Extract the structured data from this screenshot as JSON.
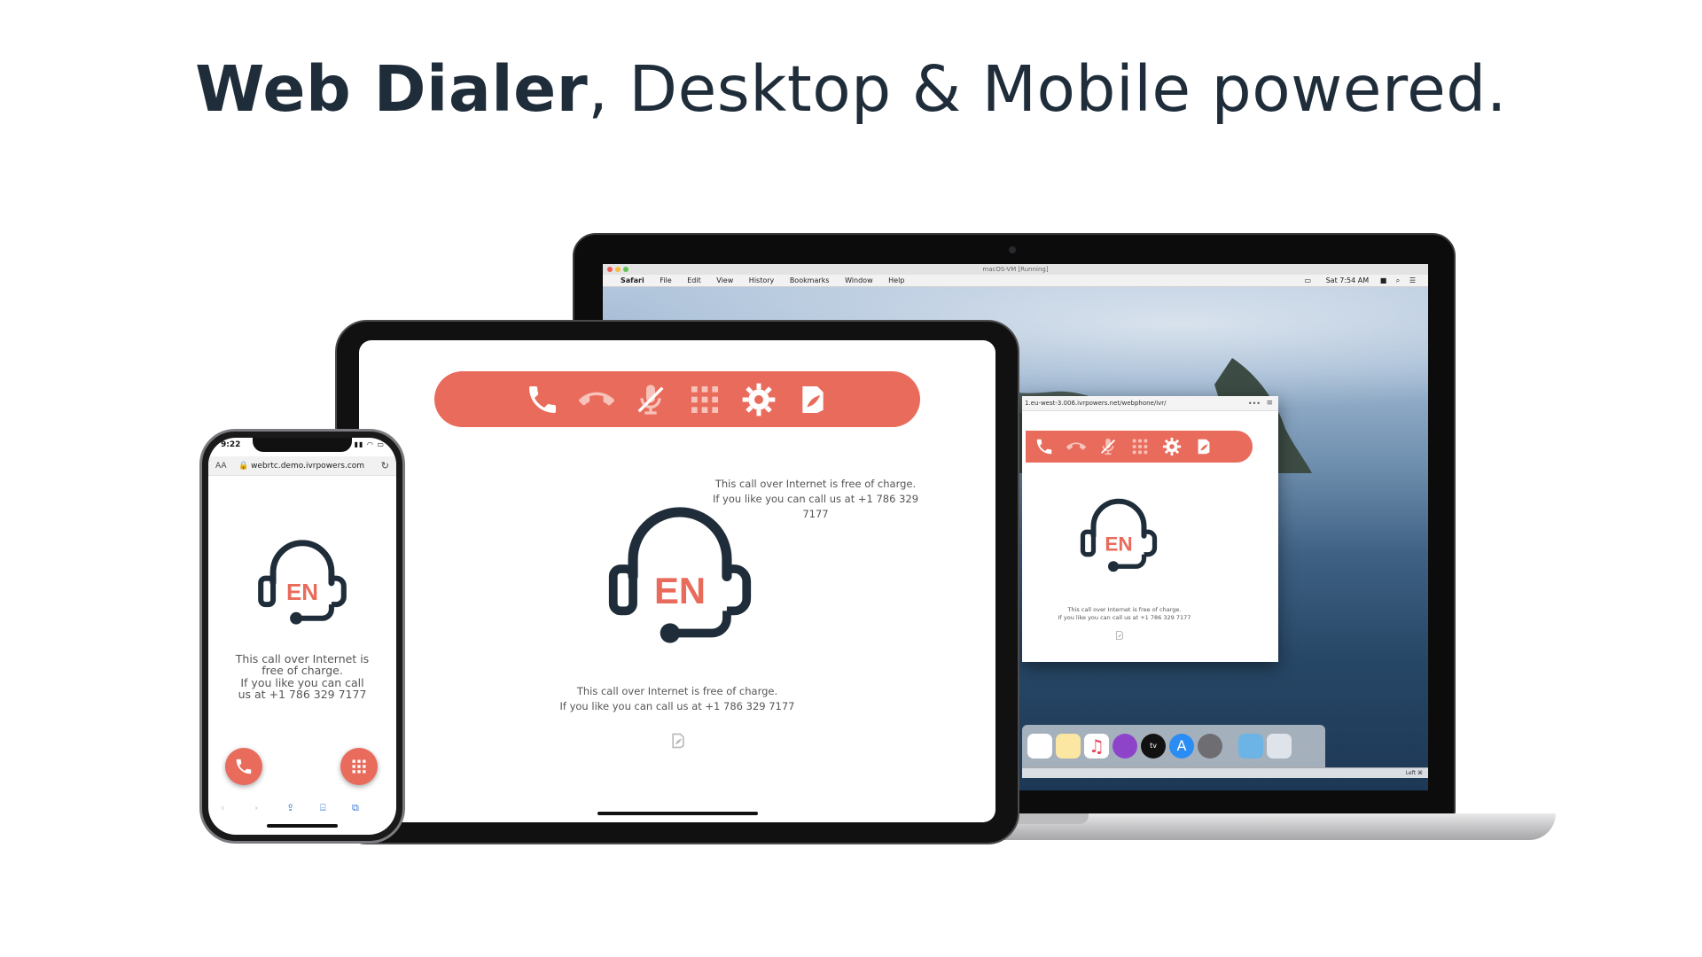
{
  "headline": {
    "bold": "Web Dialer",
    "rest": ", Desktop & Mobile powered."
  },
  "laptop": {
    "window_title": "macOS-VM [Running]",
    "menu": [
      "Safari",
      "File",
      "Edit",
      "View",
      "History",
      "Bookmarks",
      "Window",
      "Help"
    ],
    "status_time": "Sat 7:54 AM",
    "browser_url": "1.eu-west-3.006.ivrpowers.net/webphone/ivr/",
    "note_line1": "This call over Internet is free of charge.",
    "note_line2": "If you like you can call us at +1 786 329 7177",
    "dock_strip_label": "Left ⌘"
  },
  "tablet": {
    "note_top_line1": "This call over Internet is free of charge.",
    "note_top_line2": "If you like you can call us at +1 786 329 7177",
    "note_line1": "This call over Internet is free of charge.",
    "note_line2": "If you like you can call us at +1 786 329 7177"
  },
  "phone": {
    "time": "9:22",
    "aa": "AA",
    "url": "🔒 webrtc.demo.ivrpowers.com",
    "note_line1": "This call over Internet is",
    "note_line2": "free of charge.",
    "note_line3": "If you like you can call",
    "note_line4": "us at +1 786 329 7177"
  },
  "logo_text": "EN",
  "toolbar_icons": [
    "phone-icon",
    "hangup-icon",
    "mute-mic-icon",
    "keypad-icon",
    "gear-icon",
    "leaf-doc-icon"
  ],
  "colors": {
    "accent": "#e96b5c",
    "headline": "#1f2d3a",
    "logo_dark": "#1f2d3a"
  }
}
